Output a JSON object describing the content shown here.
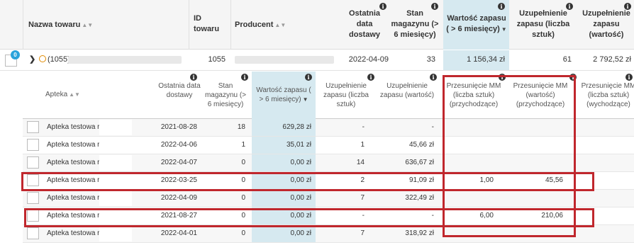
{
  "header": {
    "columns": {
      "name": "Nazwa towaru",
      "id": "ID towaru",
      "producer": "Producent",
      "last_delivery": "Ostatnia data dostawy",
      "stock": "Stan magazynu (> 6 miesięcy)",
      "stock_value": "Wartość zapasu ( > 6 miesięcy)",
      "refill_qty": "Uzupełnienie zapasu (liczba sztuk)",
      "refill_value": "Uzupełnienie zapasu (wartość)"
    }
  },
  "product": {
    "badge": "0",
    "expand_glyph": "❯",
    "status_icon": "clock-icon",
    "name_prefix": "(1055)",
    "id": "1055",
    "last_delivery": "2022-04-09",
    "stock": "33",
    "stock_value": "1 156,34 zł",
    "refill_qty": "61",
    "refill_value": "2 792,52 zł"
  },
  "subheader": {
    "pharmacy": "Apteka",
    "last_delivery": "Ostatnia data dostawy",
    "stock": "Stan magazynu (> 6 miesięcy)",
    "stock_value": "Wartość zapasu ( > 6 miesięcy)",
    "refill_qty": "Uzupełnienie zapasu (liczba sztuk)",
    "refill_value": "Uzupełnienie zapasu (wartość)",
    "mm_in_qty": "Przesunięcie MM (liczba sztuk) (przychodzące)",
    "mm_in_value": "Przesunięcie MM (wartość) (przychodzące)",
    "mm_out_qty": "Przesunięcie MM (liczba sztuk) (wychodzące)"
  },
  "rows": [
    {
      "name": "Apteka testowa r",
      "date": "2021-08-28",
      "stock": "18",
      "value": "629,28 zł",
      "refill_qty": "-",
      "refill_value": "-",
      "mm_qty": "",
      "mm_value": ""
    },
    {
      "name": "Apteka testowa r",
      "date": "2022-04-06",
      "stock": "1",
      "value": "35,01 zł",
      "refill_qty": "1",
      "refill_value": "45,66 zł",
      "mm_qty": "",
      "mm_value": ""
    },
    {
      "name": "Apteka testowa r",
      "date": "2022-04-07",
      "stock": "0",
      "value": "0,00 zł",
      "refill_qty": "14",
      "refill_value": "636,67 zł",
      "mm_qty": "",
      "mm_value": ""
    },
    {
      "name": "Apteka testowa r",
      "date": "2022-03-25",
      "stock": "0",
      "value": "0,00 zł",
      "refill_qty": "2",
      "refill_value": "91,09 zł",
      "mm_qty": "1,00",
      "mm_value": "45,56"
    },
    {
      "name": "Apteka testowa r",
      "date": "2022-04-09",
      "stock": "0",
      "value": "0,00 zł",
      "refill_qty": "7",
      "refill_value": "322,49 zł",
      "mm_qty": "",
      "mm_value": ""
    },
    {
      "name": "Apteka testowa r",
      "date": "2021-08-27",
      "stock": "0",
      "value": "0,00 zł",
      "refill_qty": "-",
      "refill_value": "-",
      "mm_qty": "6,00",
      "mm_value": "210,06"
    },
    {
      "name": "Apteka testowa r",
      "date": "2022-04-01",
      "stock": "0",
      "value": "0,00 zł",
      "refill_qty": "7",
      "refill_value": "318,92 zł",
      "mm_qty": "",
      "mm_value": ""
    }
  ],
  "colors": {
    "highlight": "#d6e9f0",
    "annotation_red": "#c0272d"
  }
}
